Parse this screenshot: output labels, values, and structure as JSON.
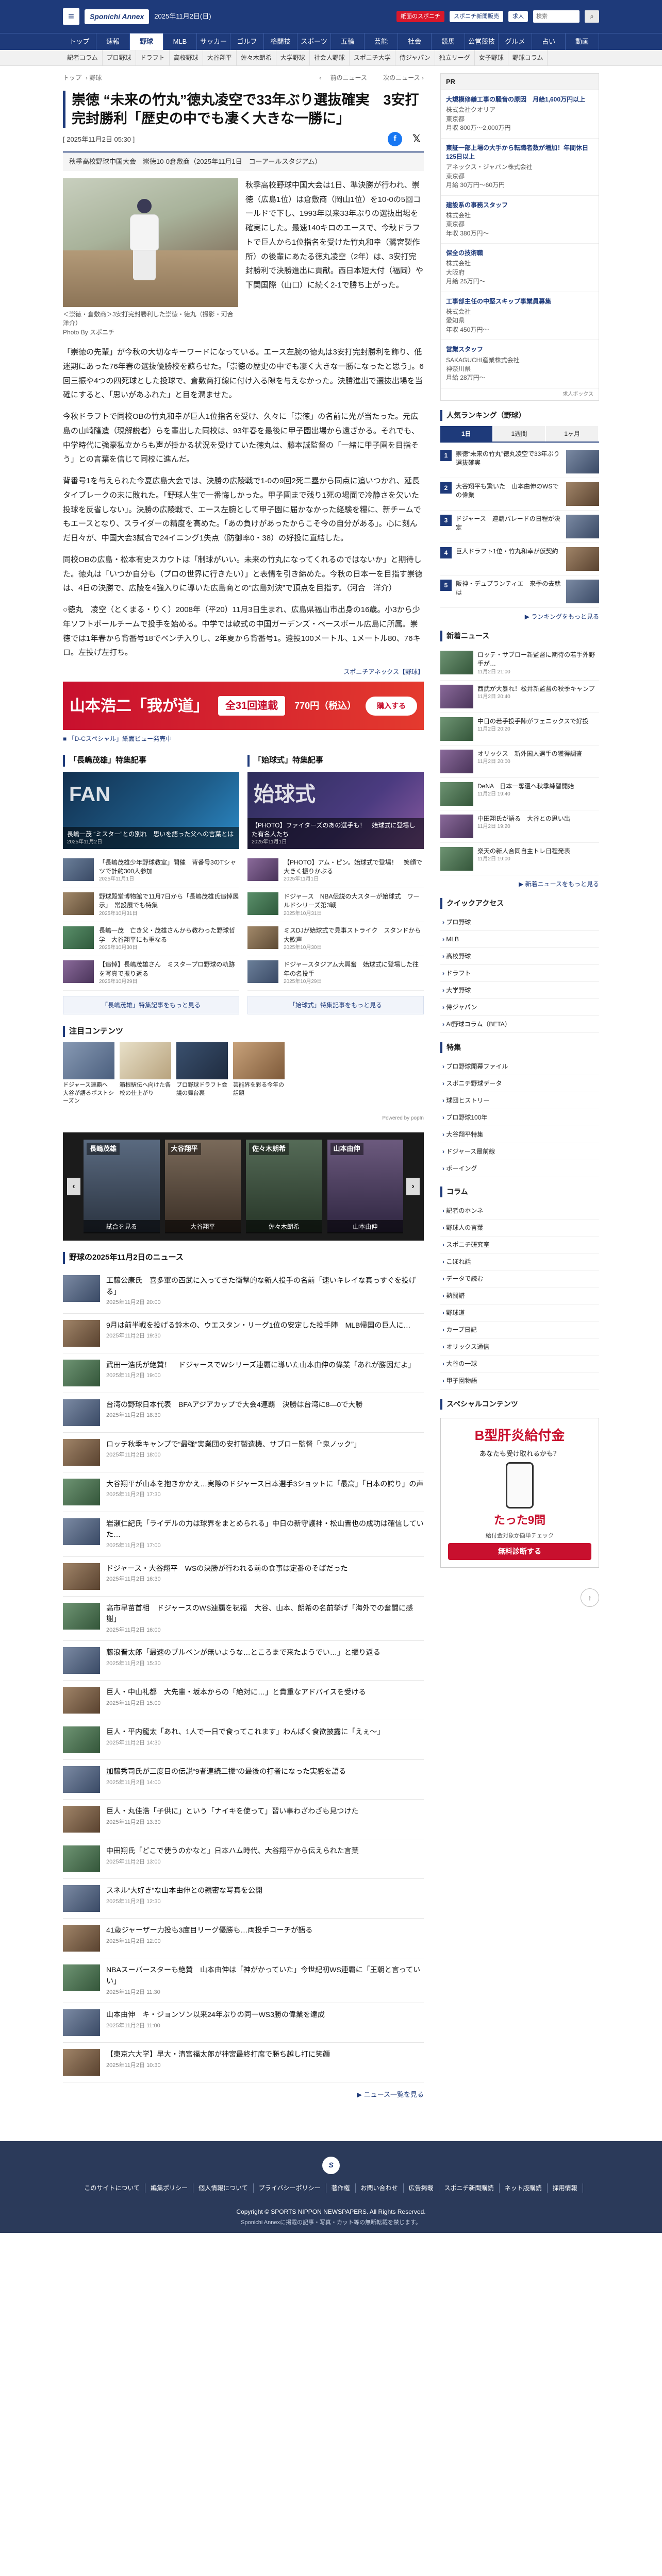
{
  "header": {
    "logo": "Sponichi Annex",
    "date": "2025年11月2日(日)",
    "btn_subscribe": "紙面のスポニチ",
    "btn_epaper": "スポニチ新聞販売",
    "btn_kyujin": "求人",
    "search_placeholder": "検索",
    "search_icon": "search-icon"
  },
  "nav_main": [
    "トップ",
    "速報",
    "野球",
    "MLB",
    "サッカー",
    "ゴルフ",
    "格闘技",
    "スポーツ",
    "五輪",
    "芸能",
    "社会",
    "競馬",
    "公営競技",
    "グルメ",
    "占い",
    "動画"
  ],
  "nav_sub": [
    "記者コラム",
    "プロ野球",
    "ドラフト",
    "高校野球",
    "大谷翔平",
    "佐々木朗希",
    "大学野球",
    "社会人野球",
    "スポニチ大学",
    "侍ジャパン",
    "独立リーグ",
    "女子野球",
    "野球コラム"
  ],
  "breadcrumb": [
    "トップ",
    "野球"
  ],
  "prev_label": "前のニュース",
  "next_label": "次のニュース",
  "article": {
    "headline": "崇徳 “未来の竹丸”徳丸凌空で33年ぶり選抜確実　3安打完封勝利「歴史の中でも凄く大きな一勝に」",
    "date": "[ 2025年11月2日 05:30 ]",
    "game": "秋季高校野球中国大会　崇徳10-0倉敷商（2025年11月1日　コーアールスタジアム）",
    "caption": "＜崇徳・倉敷商＞3安打完封勝利した崇徳・徳丸（撮影・河合　洋介）",
    "photo_credit": "Photo By スポニチ",
    "p1": "秋季高校野球中国大会は1日、準決勝が行われ、崇徳（広島1位）は倉敷商（岡山1位）を10-0の5回コールドで下し、1993年以来33年ぶりの選抜出場を確実にした。最速140キロのエースで、今秋ドラフトで巨人から1位指名を受けた竹丸和幸（鷺宮製作所）の後輩にあたる徳丸凌空（2年）は、3安打完封勝利で決勝進出に貢献。西日本短大付（福岡）や下関国際（山口）に続く2-1で勝ち上がった。",
    "p2": "「崇徳の先輩」が今秋の大切なキーワードになっている。エース左腕の徳丸は3安打完封勝利を飾り、低迷期にあった76年春の選抜優勝校を蘇らせた。「崇徳の歴史の中でも凄く大きな一勝になったと思う」。6回三振や4つの四死球とした投球で、倉敷商打線に付け入る隙を与えなかった。決勝進出で選抜出場を当確にすると、「思いがあふれた」と目を潤ませた。",
    "p3": "今秋ドラフトで同校OBの竹丸和幸が巨人1位指名を受け、久々に「崇徳」の名前に光が当たった。元広島の山崎隆造（現解説者）らを輩出した同校は、93年春を最後に甲子園出場から遠ざかる。それでも、中学時代に強豪私立からも声が掛かる状況を受けていた徳丸は、藤本誠監督の「一緒に甲子園を目指そう」との言葉を信じて同校に進んだ。",
    "p4": "背番号1を与えられた今夏広島大会では、決勝の広陵戦で1-0の9回2死二塁から同点に追いつかれ、延長タイブレークの末に敗れた。「野球人生で一番悔しかった。甲子園まで残り1死の場面で冷静さを欠いた投球を反省しない」。決勝の広陵戦で、エース左腕として甲子園に届かなかった経験を糧に、新チームでもエースとなり、スライダーの精度を高めた。「あの負けがあったからこそ今の自分がある」。心に刻んだ日々が、中国大会3試合で24イニング1失点（防御率0・38）の好投に直結した。",
    "p5": "同校OBの広島・松本有史スカウトは「制球がいい。未来の竹丸になってくれるのではないか」と期待した。徳丸は「いつか自分も（プロの世界に行きたい）」と表情を引き締めた。今秋の日本一を目指す崇徳は、4日の決勝で、広陵を4強入りに導いた広島商との“広島対決”で頂点を目指す。（河合　洋介）",
    "p6": "○徳丸　凌空（とくまる・りく）2008年（平20）11月3日生まれ、広島県福山市出身の16歳。小3から少年ソフトボールチームで投手を始める。中学では軟式の中国ガーデンズ・ベースボール広島に所属。崇徳では1年春から背番号18でベンチ入りし、2年夏から背番号1。遠投100メートル、1メートル80、76キロ。左投げ左打ち。",
    "source": "スポニチアネックス【野球】"
  },
  "banner": {
    "title": "山本浩二「我が道」",
    "badge": "全31回連載",
    "price": "770円（税込）",
    "cta": "購入する"
  },
  "promo_link": "■ 「D-Cスペシャル」紙面ビュー発売中",
  "left_feature": {
    "title": "「長嶋茂雄」特集記事",
    "feature_caption": "長嶋一茂 “ミスター”との別れ　思いを語った父への言葉とは",
    "feature_date": "2025年11月2日",
    "feature_tag": "FAN",
    "items": [
      {
        "title": "「長嶋茂雄少年野球教室」開催　背番号3のTシャツで計約300人参加",
        "date": "2025年11月1日"
      },
      {
        "title": "野球殿堂博物館で11月7日から「長嶋茂雄氏追悼展示」　常設展でも特集",
        "date": "2025年10月31日"
      },
      {
        "title": "長嶋一茂　亡き父・茂雄さんから教わった野球哲学　大谷翔平にも重なる",
        "date": "2025年10月30日"
      },
      {
        "title": "【追悼】長嶋茂雄さん　ミスタープロ野球の軌跡を写真で振り返る",
        "date": "2025年10月29日"
      }
    ],
    "more": "「長嶋茂雄」特集記事をもっと見る"
  },
  "right_feature": {
    "title": "「始球式」特集記事",
    "feature_caption": "【PHOTO】ファイターズのあの選手も！　始球式に登場した有名人たち",
    "feature_date": "2025年11月1日",
    "feature_tag": "始球式",
    "items": [
      {
        "title": "【PHOTO】アム・ピン。始球式で登場！　笑顔で大きく振りかぶる",
        "date": "2025年11月1日"
      },
      {
        "title": "ドジャース　NBA伝説の大スターが始球式　ワールドシリーズ第3戦",
        "date": "2025年10月31日"
      },
      {
        "title": "ミスDJが始球式で見事ストライク　スタンドから大歓声",
        "date": "2025年10月30日"
      },
      {
        "title": "ドジャースタジアム大興奮　始球式に登場した往年の名投手",
        "date": "2025年10月29日"
      }
    ],
    "more": "「始球式」特集記事をもっと見る"
  },
  "notice": {
    "title": "注目コンテンツ",
    "items": [
      {
        "label": "ドジャース連覇へ　大谷が語るポストシーズン"
      },
      {
        "label": "箱根駅伝へ向けた各校の仕上がり"
      },
      {
        "label": "プロ野球ドラフト会議の舞台裏"
      },
      {
        "label": "芸能界を彩る今年の話題"
      }
    ],
    "meta": "Powered by popIn"
  },
  "carousel": {
    "items": [
      {
        "label": "長嶋茂雄",
        "foot": "試合を見る"
      },
      {
        "label": "大谷翔平",
        "foot": "大谷翔平"
      },
      {
        "label": "佐々木朗希",
        "foot": "佐々木朗希"
      },
      {
        "label": "山本由伸",
        "foot": "山本由伸"
      }
    ]
  },
  "news_section": {
    "title": "野球の2025年11月2日のニュース",
    "items": [
      {
        "title": "工藤公康氏　喜多軍の西武に入ってきた衝撃的な新人投手の名前「速いキレイな真っすぐを投げる」",
        "date": "2025年11月2日 20:00"
      },
      {
        "title": "9月は前半戦を投げる鈴木の、ウエスタン・リーグ1位の安定した投手陣　MLB帰国の巨人に…",
        "date": "2025年11月2日 19:30"
      },
      {
        "title": "武田一浩氏が絶賛！　ドジャースでWシリーズ連覇に導いた山本由伸の偉業「あれが勝因だよ」",
        "date": "2025年11月2日 19:00"
      },
      {
        "title": "台湾の野球日本代表　BFAアジアカップで大会4連覇　決勝は台湾に8―0で大勝",
        "date": "2025年11月2日 18:30"
      },
      {
        "title": "ロッテ秋季キャンプで“最強”実業団の安打製造機、サブロー監督「“鬼ノック”」",
        "date": "2025年11月2日 18:00"
      },
      {
        "title": "大谷翔平が山本を抱きかかえ…実際のドジャース日本選手3ショットに「最高」「日本の誇り」の声",
        "date": "2025年11月2日 17:30"
      },
      {
        "title": "岩瀬仁紀氏「ライデルの力は球界をまとめられる」中日の新守護神・松山晋也の成功は確信していた…",
        "date": "2025年11月2日 17:00"
      },
      {
        "title": "ドジャース・大谷翔平　WSの決勝が行われる前の食事は定番のそばだった",
        "date": "2025年11月2日 16:30"
      },
      {
        "title": "高市早苗首相　ドジャースのWS連覇を祝福　大谷、山本、朗希の名前挙げ「海外での奮闘に感謝」",
        "date": "2025年11月2日 16:00"
      },
      {
        "title": "藤浪晋太郎「最速のブルペンが無いような…ところまで来たようでい…」と振り返る",
        "date": "2025年11月2日 15:30"
      },
      {
        "title": "巨人・中山礼都　大先輩・坂本からの「絶対に…」と貴重なアドバイスを受ける",
        "date": "2025年11月2日 15:00"
      },
      {
        "title": "巨人・平内龍太「あれ、1人で一日で食ってこれます」わんぱく食欲披露に「えぇ〜」",
        "date": "2025年11月2日 14:30"
      },
      {
        "title": "加藤秀司氏が三度目の伝説“9者連続三振”の最後の打者になった実感を語る",
        "date": "2025年11月2日 14:00"
      },
      {
        "title": "巨人・丸佳浩「子供に」という「ナイキを使って」習い事わざわざも見つけた",
        "date": "2025年11月2日 13:30"
      },
      {
        "title": "中田翔氏「どこで使うのかなと」日本ハム時代、大谷翔平から伝えられた言葉",
        "date": "2025年11月2日 13:00"
      },
      {
        "title": "スネル“大好き”な山本由伸との親密な写真を公開",
        "date": "2025年11月2日 12:30"
      },
      {
        "title": "41歳ジャーザー力投も3度目リーグ優勝も…両投手コーチが語る",
        "date": "2025年11月2日 12:00"
      },
      {
        "title": "NBAスーパースターも絶賛　山本由伸は「神がかっていた」今世紀初WS連覇に「王朝と言っていい」",
        "date": "2025年11月2日 11:30"
      },
      {
        "title": "山本由伸　キ・ジョンソン以来24年ぶりの同一WS3勝の偉業を達成",
        "date": "2025年11月2日 11:00"
      },
      {
        "title": "【東京六大学】早大・清宮福太郎が神宮最終打席で勝ち越し打に笑顔",
        "date": "2025年11月2日 10:30"
      }
    ],
    "more": "▶ ニュース一覧を見る"
  },
  "side": {
    "ad_head": "PR",
    "ads": [
      {
        "title": "大規模修繕工事の騒音の原因　月給1,600万円以上",
        "lines": [
          "株式会社クオリア",
          "東京都",
          "月収 800万〜2,000万円"
        ]
      },
      {
        "title": "東証一部上場の大手から転職者数が増加！年間休日125日以上",
        "lines": [
          "アネックス・ジャパン株式会社",
          "東京都",
          "月給 30万円〜60万円"
        ]
      },
      {
        "title": "建設系の事務スタッフ",
        "lines": [
          "株式会社",
          "東京都",
          "年収 380万円〜"
        ]
      },
      {
        "title": "保全の技術職",
        "lines": [
          "株式会社",
          "大阪府",
          "月給 25万円〜"
        ]
      },
      {
        "title": "工事部主任の中堅スキップ事業員募集",
        "lines": [
          "株式会社",
          "愛知県",
          "年収 450万円〜"
        ]
      },
      {
        "title": "営業スタッフ",
        "lines": [
          "SAKAGUCHI産業株式会社",
          "神奈川県",
          "月給 28万円〜"
        ]
      }
    ],
    "ad_foot": "求人ボックス",
    "ranking_title": "人気ランキング（野球）",
    "ranking_tabs": [
      "1日",
      "1週間",
      "1ヶ月"
    ],
    "ranking": [
      {
        "num": "1",
        "title": "崇徳“未来の竹丸”徳丸凌空で33年ぶり選抜確実"
      },
      {
        "num": "2",
        "title": "大谷翔平も驚いた　山本由伸のWSでの偉業"
      },
      {
        "num": "3",
        "title": "ドジャース　連覇パレードの日程が決定"
      },
      {
        "num": "4",
        "title": "巨人ドラフト1位・竹丸和幸が仮契約"
      },
      {
        "num": "5",
        "title": "阪神・デュプランティエ　来季の去就は"
      }
    ],
    "ranking_more": "▶ ランキングをもっと見る",
    "new_title": "新着ニュース",
    "news": [
      {
        "title": "ロッテ・サブロー新監督に期待の若手外野手が…",
        "date": "11月2日 21:00"
      },
      {
        "title": "西武が大暴れ！松井新監督の秋季キャンプ",
        "date": "11月2日 20:40"
      },
      {
        "title": "中日の若手投手陣がフェニックスで好投",
        "date": "11月2日 20:20"
      },
      {
        "title": "オリックス　新外国人選手の獲得調査",
        "date": "11月2日 20:00"
      },
      {
        "title": "DeNA　日本一奪還へ秋季練習開始",
        "date": "11月2日 19:40"
      },
      {
        "title": "中田翔氏が語る　大谷との思い出",
        "date": "11月2日 19:20"
      },
      {
        "title": "楽天の新人合同自主トレ日程発表",
        "date": "11月2日 19:00"
      }
    ],
    "new_more": "▶ 新着ニュースをもっと見る",
    "quick_title": "クイックアクセス",
    "quick": [
      "プロ野球",
      "MLB",
      "高校野球",
      "ドラフト",
      "大学野球",
      "侍ジャパン",
      "AI野球コラム（BETA）"
    ],
    "special_title": "特集",
    "specials": [
      "プロ野球開幕ファイル",
      "スポニチ野球データ",
      "球団ヒストリー",
      "プロ野球100年",
      "大谷翔平特集",
      "ドジャース最前線",
      "ボーイング"
    ],
    "column_title": "コラム",
    "columns": [
      "記者のホンネ",
      "野球人の言葉",
      "スポニチ研究室",
      "こぼれ話",
      "データで読む",
      "熱闘譜",
      "野球道",
      "カープ日記",
      "オリックス通信",
      "大谷の一球",
      "甲子園物語"
    ],
    "sp_title": "スペシャルコンテンツ",
    "ad_a1": "B型肝炎給付金",
    "ad_a2": "あなたも受け取れるかも？",
    "ad_a3": "たった9問",
    "ad_a4": "給付金対象か簡単チェック",
    "ad_a5": "無料診断する"
  },
  "footer": {
    "logo": "S",
    "links": [
      "このサイトについて",
      "編集ポリシー",
      "個人情報について",
      "プライバシーポリシー",
      "著作権",
      "お問い合わせ",
      "広告掲載",
      "スポニチ新聞購読",
      "ネット版購読",
      "採用情報"
    ],
    "copy": "Copyright © SPORTS NIPPON NEWSPAPERS. All Rights Reserved.",
    "note": "Sponichi Annexに掲載の記事・写真・カット等の無断転載を禁じます。"
  }
}
